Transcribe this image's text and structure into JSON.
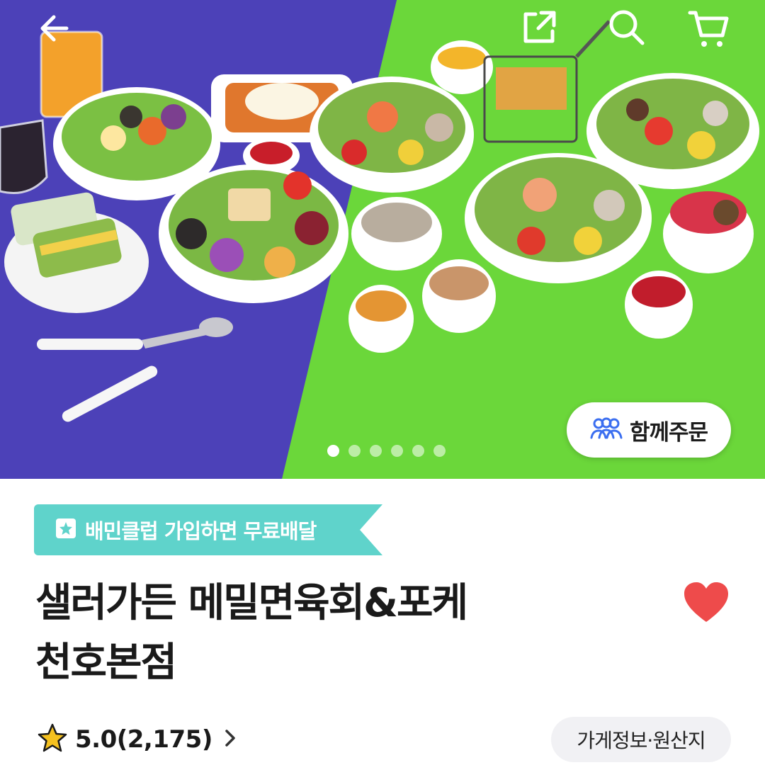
{
  "hero": {
    "colors": {
      "left_bg": "#4a3fb0",
      "right_bg": "#6bd73a"
    },
    "icons": {
      "back": "back-arrow-icon",
      "share": "share-icon",
      "search": "search-icon",
      "cart": "cart-icon"
    },
    "together_order": {
      "icon": "group-people-icon",
      "label": "함께주문"
    },
    "carousel": {
      "total": 6,
      "active_index": 1
    }
  },
  "promo": {
    "icon": "baemin-club-icon",
    "text": "배민클럽 가입하면 무료배달",
    "color": "#5fd3cb"
  },
  "store": {
    "title_line1": "샐러가든 메밀면육회&포케",
    "title_line2": "천호본점",
    "favorited": true,
    "heart_color": "#ee4b4b"
  },
  "rating": {
    "icon": "star-icon",
    "text": "5.0(2,175)",
    "score": 5.0
  },
  "info_button": {
    "label": "가게정보·원산지"
  }
}
